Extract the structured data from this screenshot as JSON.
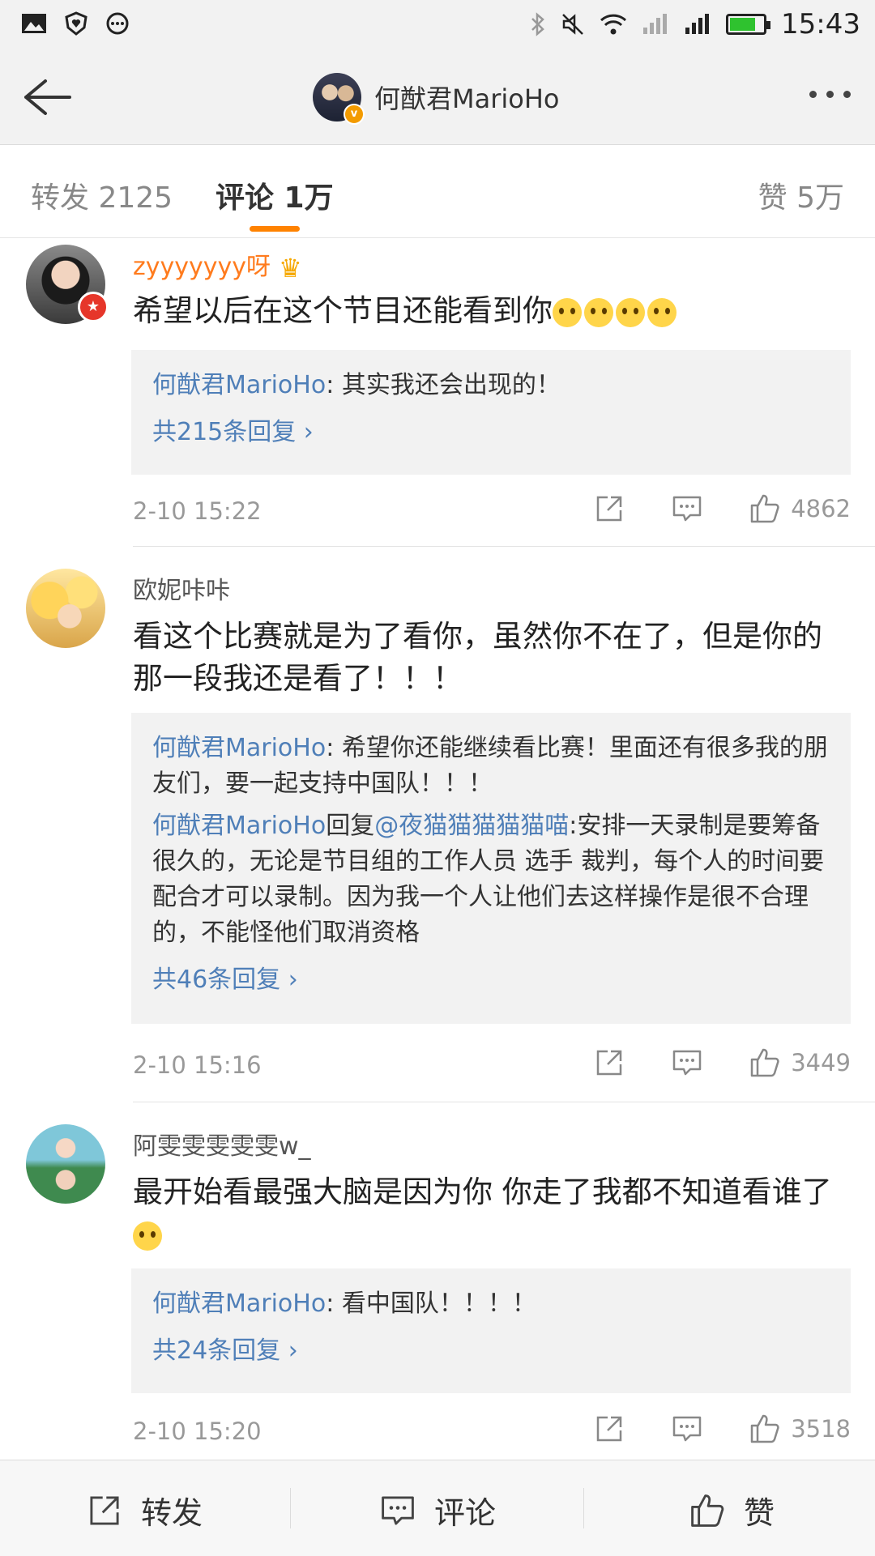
{
  "status_bar": {
    "time": "15:43",
    "battery_level": 0.8
  },
  "header": {
    "title": "何猷君MarioHo"
  },
  "tabs": [
    {
      "label": "转发 2125"
    },
    {
      "label": "评论 1万"
    },
    {
      "label": "赞 5万"
    }
  ],
  "comments": [
    {
      "user": "zyyyyyyy呀",
      "text": "希望以后在这个节目还能看到你",
      "replies": [
        {
          "name": "何猷君MarioHo",
          "text": ": 其实我还会出现的！"
        }
      ],
      "more_replies": "共215条回复 ›",
      "time": "2-10 15:22",
      "likes": "4862"
    },
    {
      "user": "欧妮咔咔",
      "text": "看这个比赛就是为了看你，虽然你不在了，但是你的那一段我还是看了！！！",
      "replies": [
        {
          "name": "何猷君MarioHo",
          "text": ": 希望你还能继续看比赛！里面还有很多我的朋友们，要一起支持中国队！！！"
        },
        {
          "name": "何猷君MarioHo",
          "mid": "回复",
          "mention": "@夜猫猫猫猫猫喵",
          "text": ":安排一天录制是要筹备很久的，无论是节目组的工作人员 选手 裁判，每个人的时间要配合才可以录制。因为我一个人让他们去这样操作是很不合理的，不能怪他们取消资格"
        }
      ],
      "more_replies": "共46条回复 ›",
      "time": "2-10 15:16",
      "likes": "3449"
    },
    {
      "user": "阿雯雯雯雯雯w_",
      "text": "最开始看最强大脑是因为你  你走了我都不知道看谁了",
      "replies": [
        {
          "name": "何猷君MarioHo",
          "text": ": 看中国队！！！！"
        }
      ],
      "more_replies": "共24条回复 ›",
      "time": "2-10 15:20",
      "likes": "3518"
    }
  ],
  "bottom_bar": {
    "repost": "转发",
    "comment": "评论",
    "like": "赞"
  }
}
